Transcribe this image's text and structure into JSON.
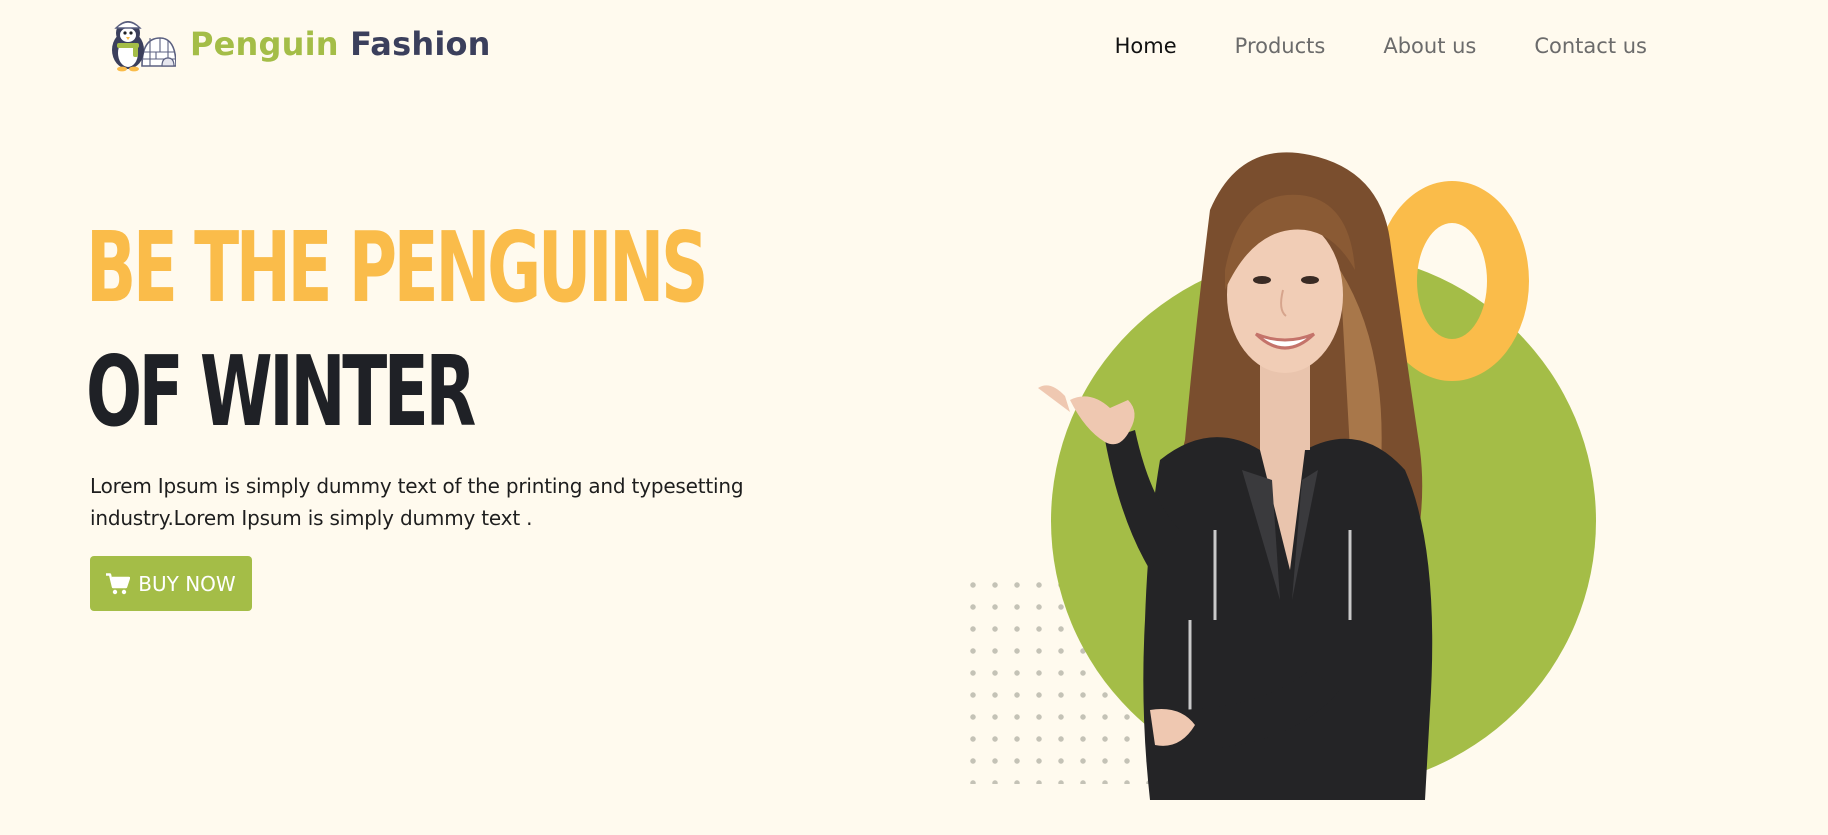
{
  "brand": {
    "name_part1": "Penguin",
    "name_part2": "Fashion",
    "logo_icon": "penguin-igloo-logo"
  },
  "nav": {
    "items": [
      {
        "label": "Home",
        "active": true
      },
      {
        "label": "Products",
        "active": false
      },
      {
        "label": "About us",
        "active": false
      },
      {
        "label": "Contact us",
        "active": false
      }
    ]
  },
  "hero": {
    "headline_line1": "BE THE PENGUINS",
    "headline_line2": "OF WINTER",
    "description": "Lorem Ipsum is simply dummy text of the printing and typesetting industry.Lorem Ipsum is simply dummy text .",
    "cta_label": "BUY NOW",
    "cta_icon": "shopping-cart-icon",
    "image": "smiling-woman-in-black-leather-jacket"
  },
  "colors": {
    "background": "#fffaee",
    "brand_green": "#a4bd47",
    "brand_navy": "#3b3f5c",
    "accent_yellow": "#fabc4a",
    "headline_dark": "#1f2126"
  }
}
